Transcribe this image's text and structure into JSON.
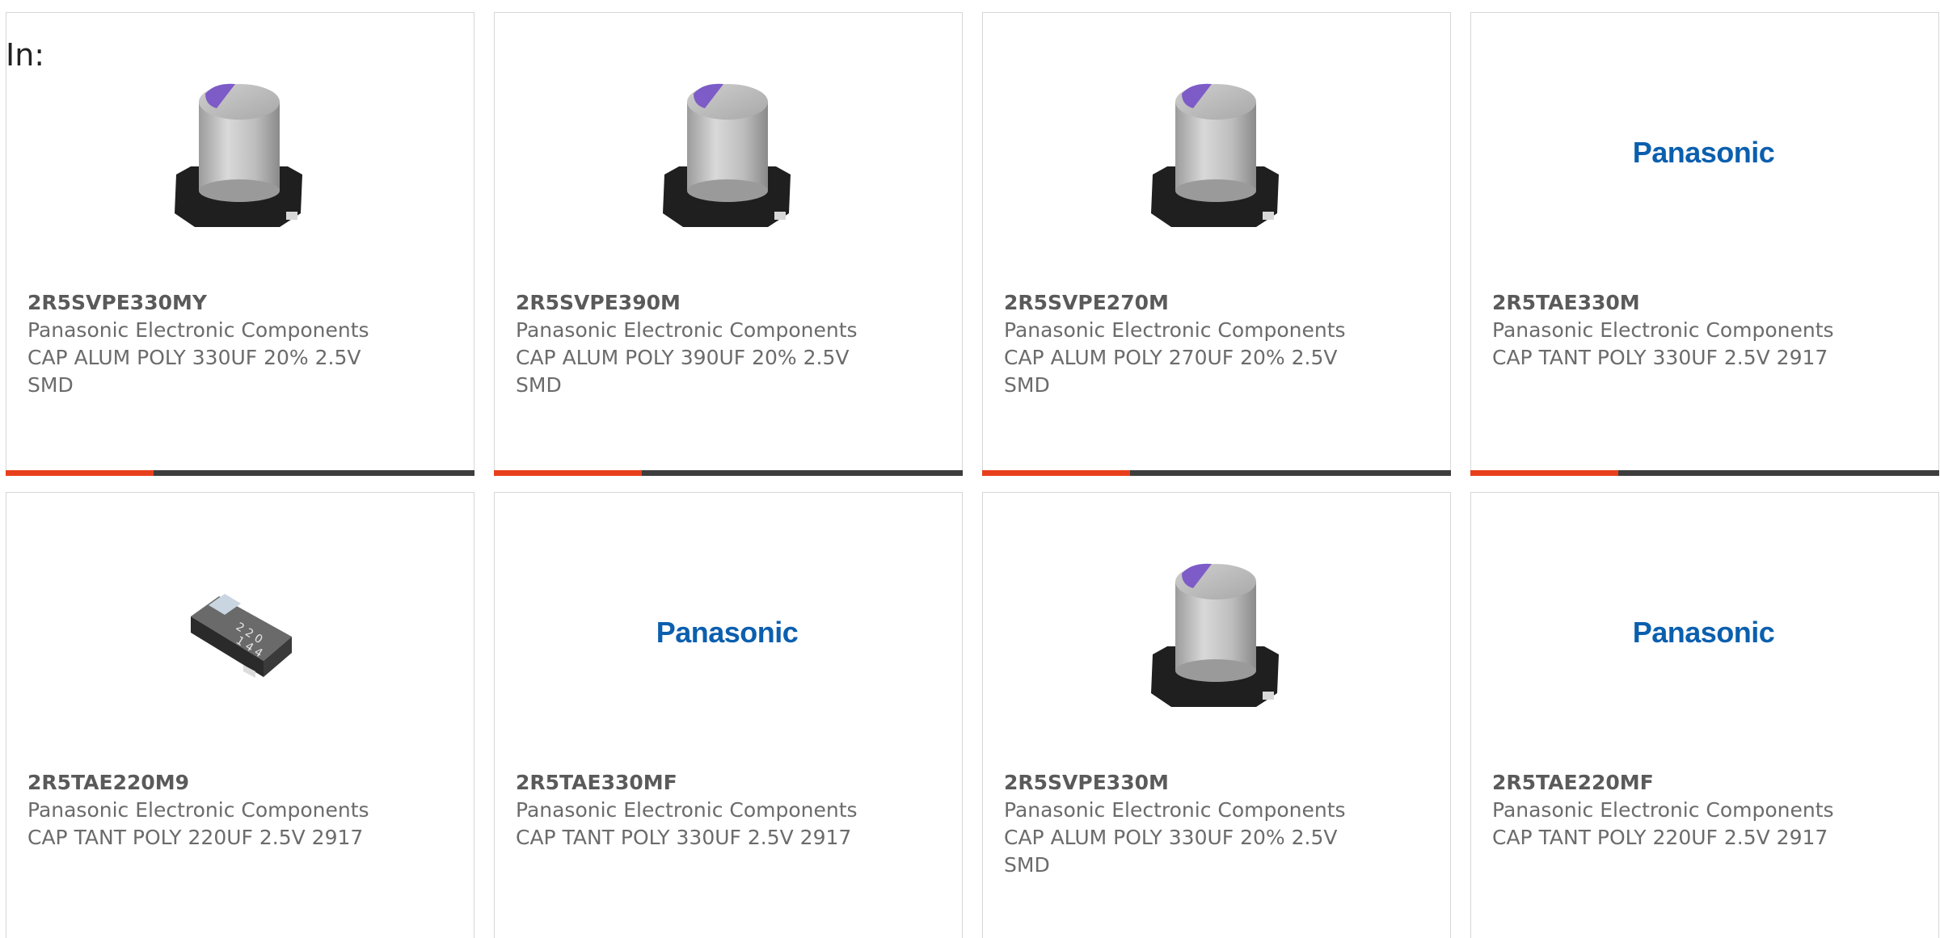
{
  "filter_label": "In:",
  "products": [
    {
      "part_number": "2R5SVPE330MY",
      "manufacturer": "Panasonic Electronic Components",
      "description": "CAP ALUM POLY 330UF 20% 2.5V SMD",
      "image": "aluminum-polymer-capacitor-image"
    },
    {
      "part_number": "2R5SVPE390M",
      "manufacturer": "Panasonic Electronic Components",
      "description": "CAP ALUM POLY 390UF 20% 2.5V SMD",
      "image": "aluminum-polymer-capacitor-image"
    },
    {
      "part_number": "2R5SVPE270M",
      "manufacturer": "Panasonic Electronic Components",
      "description": "CAP ALUM POLY 270UF 20% 2.5V SMD",
      "image": "aluminum-polymer-capacitor-image"
    },
    {
      "part_number": "2R5TAE330M",
      "manufacturer": "Panasonic Electronic Components",
      "description": "CAP TANT POLY 330UF 2.5V 2917",
      "image": "panasonic-logo",
      "logo_text": "Panasonic"
    },
    {
      "part_number": "2R5TAE220M9",
      "manufacturer": "Panasonic Electronic Components",
      "description": "CAP TANT POLY 220UF 2.5V 2917",
      "image": "tantalum-capacitor-image"
    },
    {
      "part_number": "2R5TAE330MF",
      "manufacturer": "Panasonic Electronic Components",
      "description": "CAP TANT POLY 330UF 2.5V 2917",
      "image": "panasonic-logo",
      "logo_text": "Panasonic"
    },
    {
      "part_number": "2R5SVPE330M",
      "manufacturer": "Panasonic Electronic Components",
      "description": "CAP ALUM POLY 330UF 20% 2.5V SMD",
      "image": "aluminum-polymer-capacitor-image"
    },
    {
      "part_number": "2R5TAE220MF",
      "manufacturer": "Panasonic Electronic Components",
      "description": "CAP TANT POLY 220UF 2.5V 2917",
      "image": "panasonic-logo",
      "logo_text": "Panasonic"
    }
  ],
  "colors": {
    "accent": "#e8401c",
    "bar": "#3d3d3d",
    "logo_blue": "#0b5fae",
    "capacitor_top": "#7d5cc7"
  }
}
